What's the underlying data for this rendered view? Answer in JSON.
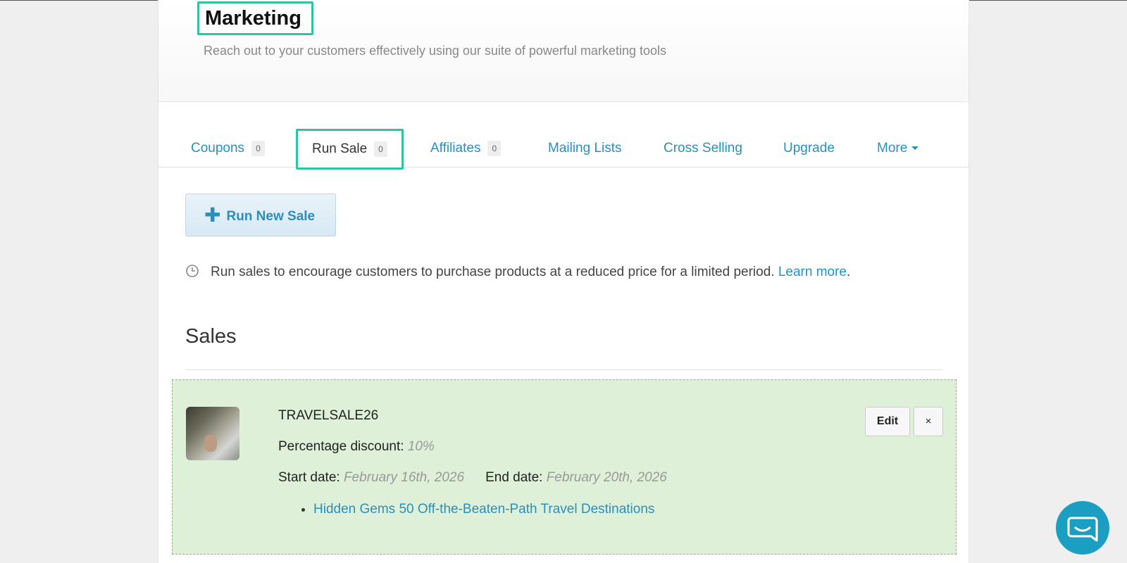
{
  "header": {
    "title": "Marketing",
    "subtitle": "Reach out to your customers effectively using our suite of powerful marketing tools"
  },
  "tabs": [
    {
      "label": "Coupons",
      "count": "0"
    },
    {
      "label": "Run Sale",
      "count": "0",
      "active": true
    },
    {
      "label": "Affiliates",
      "count": "0"
    },
    {
      "label": "Mailing Lists"
    },
    {
      "label": "Cross Selling"
    },
    {
      "label": "Upgrade"
    },
    {
      "label": "More"
    }
  ],
  "actions": {
    "new_sale_label": "Run New Sale"
  },
  "info": {
    "text": "Run sales to encourage customers to purchase products at a reduced price for a limited period. ",
    "link": "Learn more",
    "trailing": "."
  },
  "sales": {
    "heading": "Sales",
    "items": [
      {
        "code": "TRAVELSALE26",
        "discount_label": "Percentage discount:",
        "discount_value": "10%",
        "start_label": "Start date:",
        "start_value": "February 16th, 2026",
        "end_label": "End date:",
        "end_value": "February 20th, 2026",
        "products": [
          "Hidden Gems 50 Off-the-Beaten-Path Travel Destinations"
        ],
        "edit_label": "Edit",
        "remove_label": "×"
      }
    ]
  },
  "colors": {
    "accent": "#2a8fbd",
    "highlight": "#2ec4a0",
    "sale_bg": "#def0d8",
    "help_button": "#1a9fc2"
  },
  "icons": {
    "info": "clock-icon",
    "help": "chat-bubble-icon",
    "new_sale": "plus-icon"
  }
}
